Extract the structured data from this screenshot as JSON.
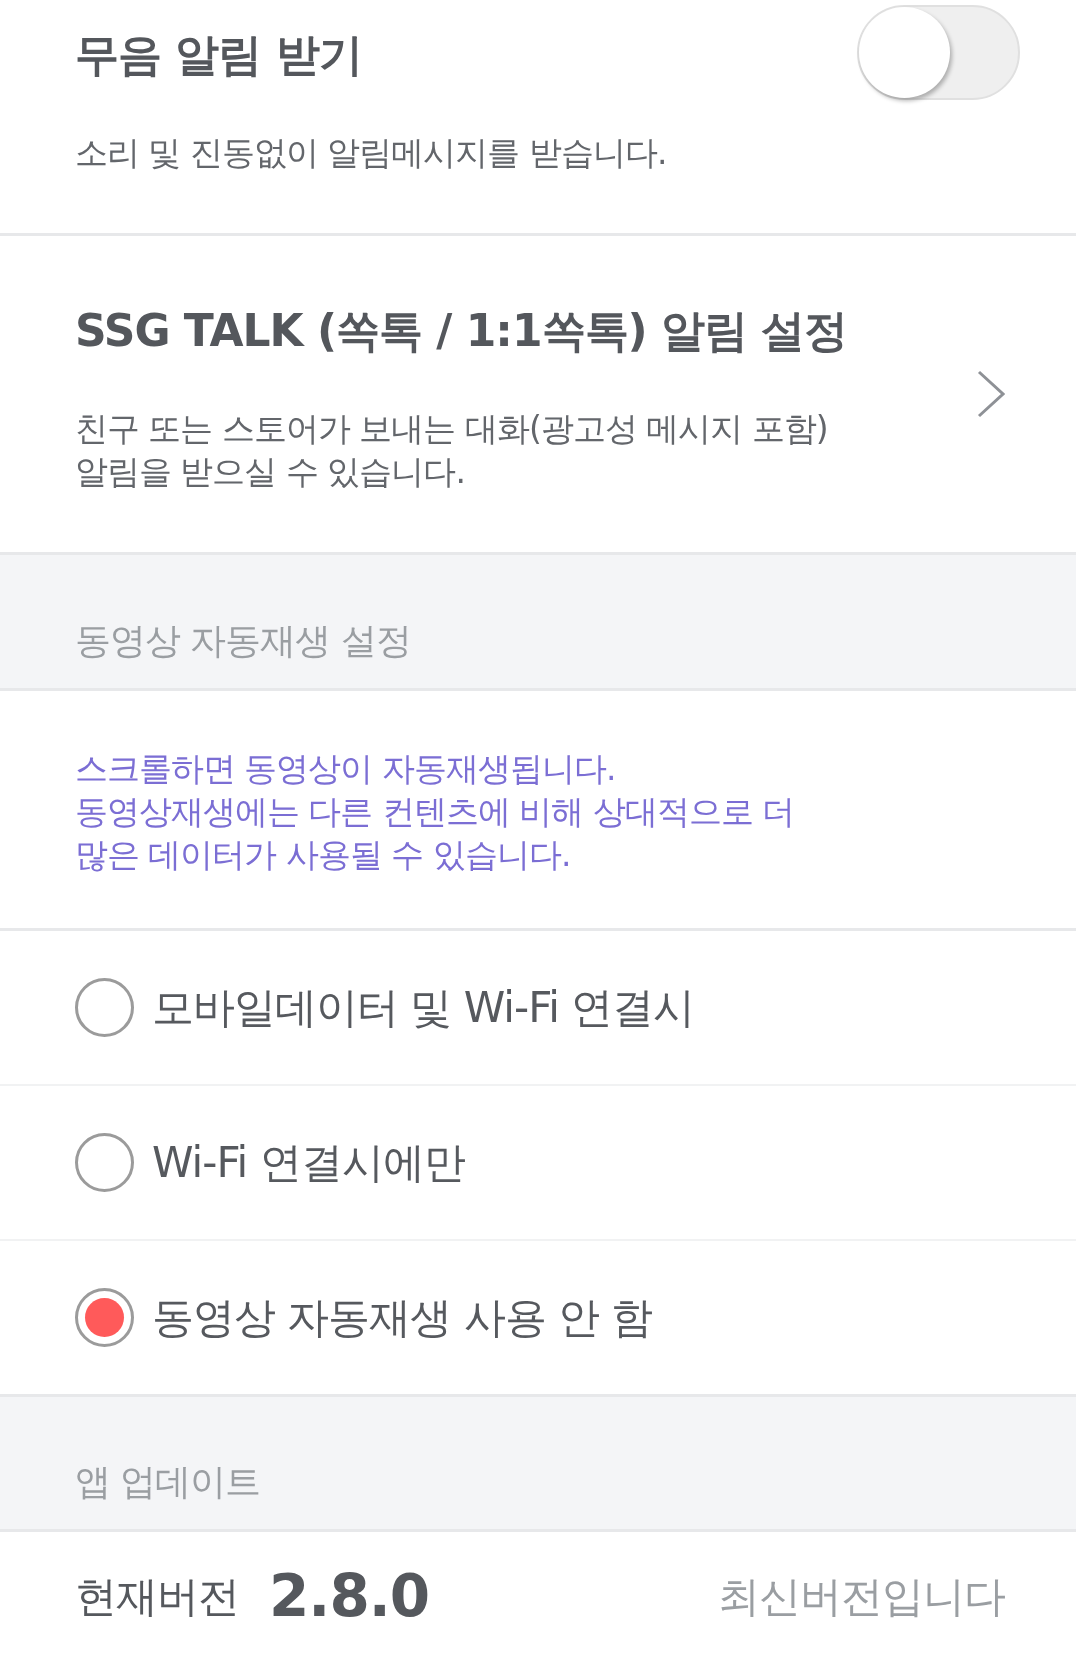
{
  "settings": [
    {
      "kind": "toggle",
      "title": "무음 알림 받기",
      "description": "소리 및 진동없이 알림메시지를 받습니다.",
      "on": false
    },
    {
      "kind": "link",
      "title": "SSG TALK (쏙톡 / 1:1쏙톡) 알림 설정",
      "description": "친구 또는 스토어가 보내는 대화(광고성 메시지 포함)\n알림을 받으실 수 있습니다."
    }
  ],
  "video_autoplay": {
    "header": "동영상 자동재생 설정",
    "notice": "스크롤하면 동영상이 자동재생됩니다.\n동영상재생에는 다른 컨텐츠에 비해 상대적으로 더\n많은 데이터가 사용될 수 있습니다.",
    "options": [
      {
        "label": "모바일데이터 및 Wi-Fi 연결시",
        "selected": false
      },
      {
        "label": "Wi-Fi 연결시에만",
        "selected": false
      },
      {
        "label": "동영상 자동재생 사용 안 함",
        "selected": true
      }
    ]
  },
  "app_update": {
    "header": "앱 업데이트",
    "version_label": "현재버전",
    "version": "2.8.0",
    "status": "최신버전입니다"
  }
}
